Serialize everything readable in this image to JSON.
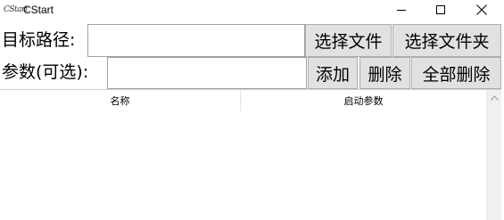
{
  "window": {
    "title": "CStart",
    "icon_text": "CStart",
    "controls": {
      "minimize": "minimize-icon",
      "maximize": "maximize-icon",
      "close": "close-icon"
    }
  },
  "target_row": {
    "label": "目标路径:",
    "value": "",
    "select_file_label": "选择文件",
    "select_folder_label": "选择文件夹"
  },
  "params_row": {
    "label": "参数(可选):",
    "value": "",
    "add_label": "添加",
    "delete_label": "删除",
    "delete_all_label": "全部删除"
  },
  "list": {
    "columns": [
      "名称",
      "启动参数"
    ],
    "rows": []
  },
  "colors": {
    "button_bg": "#e1e1e1",
    "button_border": "#adadad",
    "input_border": "#a0a0a0",
    "scrollbar_bg": "#f0f0f0"
  }
}
